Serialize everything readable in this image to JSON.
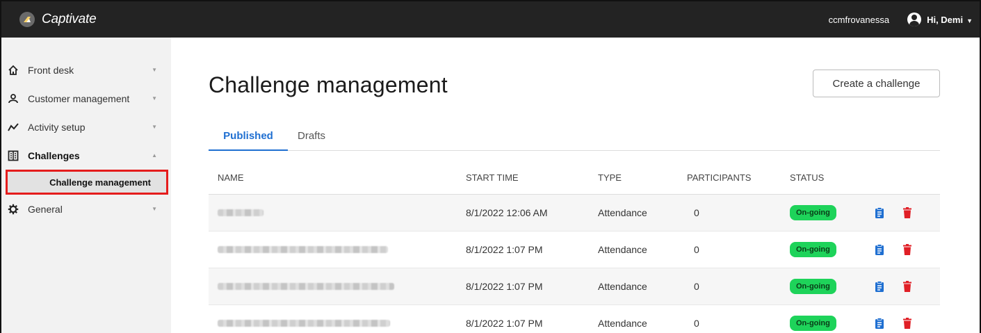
{
  "app": {
    "name": "Captivate"
  },
  "header": {
    "org": "ccmfrovanessa",
    "greeting": "Hi, Demi"
  },
  "sidebar": {
    "items": [
      {
        "label": "Front desk",
        "icon": "home-icon"
      },
      {
        "label": "Customer management",
        "icon": "user-outline-icon"
      },
      {
        "label": "Activity setup",
        "icon": "activity-line-icon"
      },
      {
        "label": "Challenges",
        "icon": "challenges-icon"
      },
      {
        "label": "General",
        "icon": "gear-icon"
      }
    ],
    "subitem": {
      "label": "Challenge management"
    }
  },
  "page": {
    "title": "Challenge management",
    "create_label": "Create a challenge"
  },
  "tabs": [
    {
      "label": "Published"
    },
    {
      "label": "Drafts"
    }
  ],
  "table": {
    "headers": [
      "NAME",
      "START TIME",
      "TYPE",
      "PARTICIPANTS",
      "STATUS"
    ],
    "rows": [
      {
        "start": "8/1/2022 12:06 AM",
        "type": "Attendance",
        "participants": "0",
        "status": "On-going"
      },
      {
        "start": "8/1/2022 1:07 PM",
        "type": "Attendance",
        "participants": "0",
        "status": "On-going"
      },
      {
        "start": "8/1/2022 1:07 PM",
        "type": "Attendance",
        "participants": "0",
        "status": "On-going"
      },
      {
        "start": "8/1/2022 1:07 PM",
        "type": "Attendance",
        "participants": "0",
        "status": "On-going"
      }
    ]
  },
  "colors": {
    "accent": "#1f6fd1",
    "status_ok": "#1ed35a",
    "delete": "#e01f26",
    "highlight": "#e51c1c"
  }
}
